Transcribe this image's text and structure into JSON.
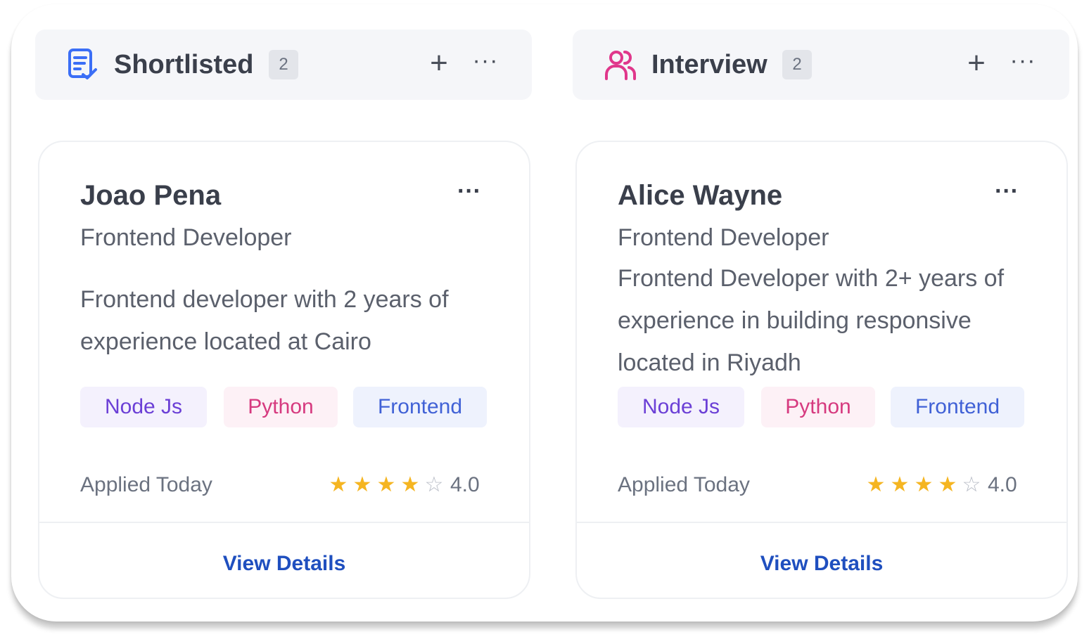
{
  "columns": [
    {
      "title": "Shortlisted",
      "count": "2",
      "icon": "shortlist-document-icon",
      "icon_color": "#3b6ef6",
      "card": {
        "name": "Joao Pena",
        "role": "Frontend Developer",
        "description": "Frontend developer with 2 years of experience located at Cairo",
        "tags": [
          "Node Js",
          "Python",
          "Frontend"
        ],
        "applied": "Applied Today",
        "rating": 4,
        "rating_label": "4.0",
        "action": "View Details"
      }
    },
    {
      "title": "Interview",
      "count": "2",
      "icon": "users-icon",
      "icon_color": "#e0378b",
      "card": {
        "name": "Alice Wayne",
        "role": "Frontend Developer",
        "description": "Frontend Developer with 2+ years of experience in building responsive located in Riyadh",
        "tags": [
          "Node Js",
          "Python",
          "Frontend"
        ],
        "applied": "Applied Today",
        "rating": 4,
        "rating_label": "4.0",
        "action": "View Details"
      }
    }
  ],
  "glyphs": {
    "plus": "+",
    "more": "···",
    "star_full": "★",
    "star_empty": "☆"
  },
  "colors": {
    "star": "#f5b521",
    "link": "#1f4fbf",
    "tag_node": "#6b3fd6",
    "tag_python": "#d63a7f",
    "tag_frontend": "#4061d6"
  }
}
